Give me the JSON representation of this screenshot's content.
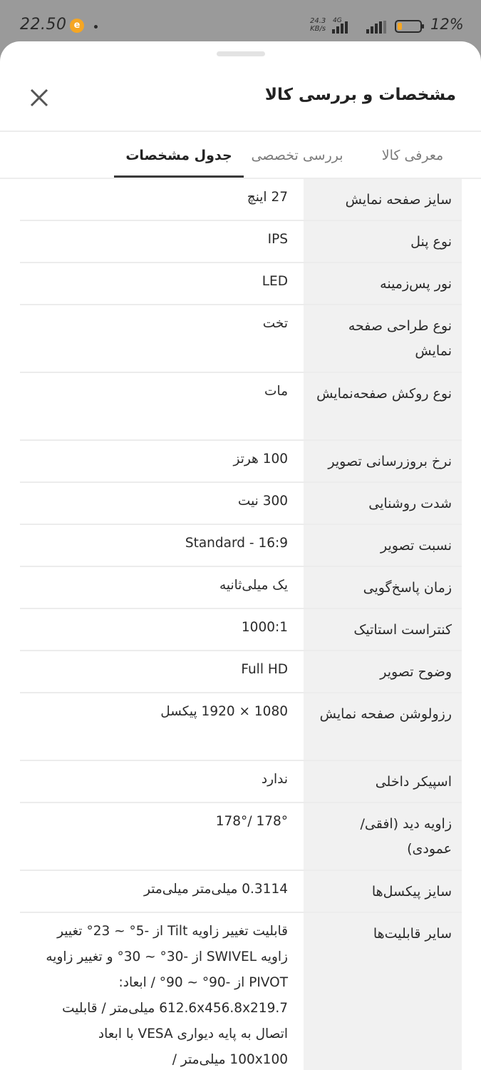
{
  "status_bar": {
    "time": "22.50",
    "net_speed_value": "24.3",
    "net_speed_unit": "KB/s",
    "network_generation": "4G",
    "battery_percent": "12%"
  },
  "header": {
    "title": "مشخصات و بررسی کالا"
  },
  "tabs": [
    {
      "label": "معرفی کالا",
      "active": false
    },
    {
      "label": "بررسی تخصصی",
      "active": false
    },
    {
      "label": "جدول مشخصات",
      "active": true
    }
  ],
  "specs": [
    {
      "label": "سایز صفحه نمایش",
      "value": "27 اینچ"
    },
    {
      "label": "نوع پنل",
      "value": "IPS"
    },
    {
      "label": "نور پس‌زمینه",
      "value": "LED"
    },
    {
      "label": "نوع طراحی صفحه نمایش",
      "value": "تخت"
    },
    {
      "label": "نوع روکش صفحه‌نمایش",
      "value": "مات"
    },
    {
      "label": "نرخ بروزرسانی تصویر",
      "value": "100 هرتز"
    },
    {
      "label": "شدت روشنایی",
      "value": "300 نیت"
    },
    {
      "label": "نسبت تصویر",
      "value": "16:9 - Standard"
    },
    {
      "label": "زمان پاسخ‌گویی",
      "value": "یک میلی‌ثانیه"
    },
    {
      "label": "کنتراست استاتیک",
      "value": "1000:1"
    },
    {
      "label": "وضوح تصویر",
      "value": "Full HD"
    },
    {
      "label": "رزولوشن صفحه نمایش",
      "value": "1080 × 1920 پیکسل"
    },
    {
      "label": "اسپیکر داخلی",
      "value": "ندارد"
    },
    {
      "label": "زاویه دید (افقی/ عمودی)",
      "value": "178° /178°"
    },
    {
      "label": "سایز پیکسل‌ها",
      "value": "0.3114 میلی‌متر میلی‌متر"
    },
    {
      "label": "سایر قابلیت‌ها",
      "value": "قابلیت تغییر زاویه Tilt از -5° ~ 23° تغییر زاویه SWIVEL از -30° ~ 30° و تغییر زاویه PIVOT از -90° ~ 90° / ابعاد: 612.6x456.8x219.7 میلی‌متر / قابلیت اتصال به پایه دیواری VESA با ابعاد 100x100 میلی‌متر /"
    }
  ]
}
